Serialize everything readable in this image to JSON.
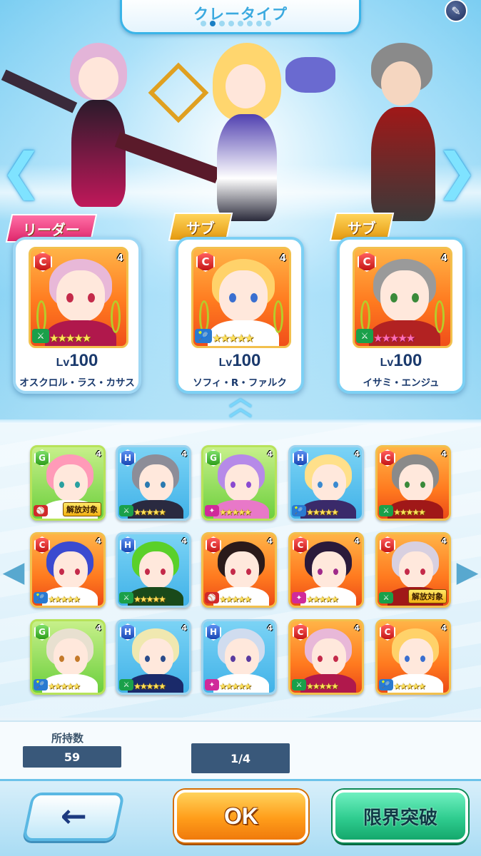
{
  "header": {
    "title": "クレータイプ",
    "page_dots": 8,
    "active_dot": 1
  },
  "party": {
    "leader_tag": "リーダー",
    "sub_tag": "サブ",
    "members": [
      {
        "role": "リーダー",
        "rank": "C",
        "limit": "4",
        "level_prefix": "Lv",
        "level": "100",
        "name": "オスクロル・ラス・カサス",
        "element": "sword",
        "stars": "★★★★★",
        "hair": "#e8b8d8",
        "eye": "#c42a4a",
        "outfit": "#b0184c",
        "star_color": "gold"
      },
      {
        "role": "サブ",
        "rank": "C",
        "limit": "4",
        "level_prefix": "Lv",
        "level": "100",
        "name": "ソフィ・R・ファルク",
        "element": "racket",
        "stars": "★★★★★",
        "hair": "#ffd26a",
        "eye": "#3a6fd0",
        "outfit": "#ffffff",
        "star_color": "gold"
      },
      {
        "role": "サブ",
        "rank": "C",
        "limit": "4",
        "level_prefix": "Lv",
        "level": "100",
        "name": "イサミ・エンジュ",
        "element": "sword",
        "stars": "★★★★★",
        "hair": "#9a9a9a",
        "eye": "#3a8a3a",
        "outfit": "#b22222",
        "star_color": "pink"
      }
    ]
  },
  "roster": {
    "units": [
      {
        "rank": "G",
        "limit": "4",
        "hair": "#ff9ab8",
        "eye": "#2aa0a0",
        "outfit": "#ffffff",
        "element": "bat",
        "stars": "",
        "badge": "解放対象",
        "tint": "g"
      },
      {
        "rank": "H",
        "limit": "4",
        "hair": "#8d8d98",
        "eye": "#2a7ab0",
        "outfit": "#2a2a40",
        "element": "sword",
        "stars": "★★★★★",
        "badge": "",
        "tint": "h"
      },
      {
        "rank": "G",
        "limit": "4",
        "hair": "#b68ae8",
        "eye": "#8a4ad0",
        "outfit": "#e878c8",
        "element": "magic",
        "stars": "★★★★★",
        "badge": "",
        "tint": "g"
      },
      {
        "rank": "H",
        "limit": "4",
        "hair": "#ffe08a",
        "eye": "#3a8ad0",
        "outfit": "#3a2a6a",
        "element": "racket",
        "stars": "★★★★★",
        "badge": "",
        "tint": "h"
      },
      {
        "rank": "C",
        "limit": "4",
        "hair": "#8a8a8a",
        "eye": "#3a8a3a",
        "outfit": "#a01818",
        "element": "sword",
        "stars": "★★★★★",
        "badge": "",
        "tint": "c"
      },
      {
        "rank": "C",
        "limit": "4",
        "hair": "#3a4ad0",
        "eye": "#c42a4a",
        "outfit": "#ffffff",
        "element": "racket",
        "stars": "★★★★★",
        "badge": "",
        "tint": "c"
      },
      {
        "rank": "H",
        "limit": "4",
        "hair": "#5ad02a",
        "eye": "#c42a4a",
        "outfit": "#1a4a1a",
        "element": "sword",
        "stars": "★★★★★",
        "badge": "",
        "tint": "h"
      },
      {
        "rank": "C",
        "limit": "4",
        "hair": "#2a1a1a",
        "eye": "#c42a4a",
        "outfit": "#ffffff",
        "element": "bat",
        "stars": "★★★★★",
        "badge": "",
        "tint": "c"
      },
      {
        "rank": "C",
        "limit": "4",
        "hair": "#2a1a3a",
        "eye": "#a02a8a",
        "outfit": "#ffffff",
        "element": "magic",
        "stars": "★★★★★",
        "badge": "",
        "tint": "c"
      },
      {
        "rank": "C",
        "limit": "4",
        "hair": "#d8d0e0",
        "eye": "#c42a4a",
        "outfit": "#a01818",
        "element": "sword",
        "stars": "",
        "badge": "解放対象",
        "tint": "c"
      },
      {
        "rank": "G",
        "limit": "4",
        "hair": "#e8e0d0",
        "eye": "#c47a2a",
        "outfit": "#ffffff",
        "element": "racket",
        "stars": "★★★★★",
        "badge": "",
        "tint": "g"
      },
      {
        "rank": "H",
        "limit": "4",
        "hair": "#f0e8b0",
        "eye": "#2a4a8a",
        "outfit": "#1a2a6a",
        "element": "sword",
        "stars": "★★★★★",
        "badge": "",
        "tint": "h"
      },
      {
        "rank": "H",
        "limit": "4",
        "hair": "#d0dcef",
        "eye": "#5a3aa0",
        "outfit": "#ffffff",
        "element": "magic",
        "stars": "★★★★★",
        "badge": "",
        "tint": "h"
      },
      {
        "rank": "C",
        "limit": "4",
        "hair": "#e8b8d8",
        "eye": "#c42a4a",
        "outfit": "#b0184c",
        "element": "sword",
        "stars": "★★★★★",
        "badge": "",
        "tint": "c"
      },
      {
        "rank": "C",
        "limit": "4",
        "hair": "#ffd26a",
        "eye": "#3a6fd0",
        "outfit": "#ffffff",
        "element": "racket",
        "stars": "★★★★★",
        "badge": "",
        "tint": "c"
      }
    ]
  },
  "info": {
    "owned_label": "所持数",
    "owned_value": "59",
    "page_value": "1/4"
  },
  "buttons": {
    "back": "←",
    "ok": "OK",
    "limit_break": "限界突破"
  },
  "colors": {
    "accent": "#3ab4e8",
    "ok_button": "#ff9d1a",
    "limit_button": "#2fcc8f",
    "info_box": "#39587a"
  }
}
